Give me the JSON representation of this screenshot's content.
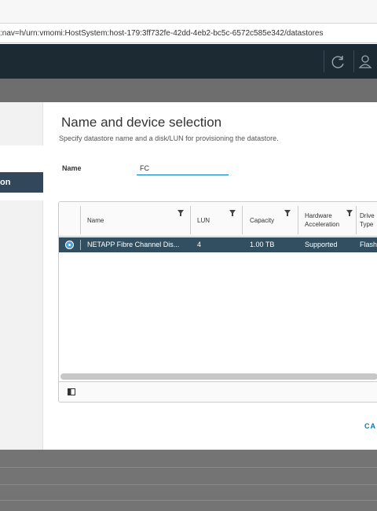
{
  "browser": {
    "address": ":nav=h/urn:vmomi:HostSystem:host-179:3ff732fe-42dd-4eb2-bc5c-6572c585e342/datastores"
  },
  "sidebar": {
    "active_step": "on"
  },
  "page": {
    "title": "Name and device selection",
    "subtitle": "Specify datastore name and a disk/LUN for provisioning the datastore."
  },
  "form": {
    "name_label": "Name",
    "name_value": "FC"
  },
  "grid": {
    "columns": [
      {
        "label": "Name"
      },
      {
        "label": "LUN"
      },
      {
        "label": "Capacity"
      },
      {
        "label": "Hardware\nAcceleration"
      },
      {
        "label": "Drive\nType"
      }
    ],
    "rows": [
      {
        "name": "NETAPP Fibre Channel Dis...",
        "lun": "4",
        "capacity": "1.00 TB",
        "hardware_acceleration": "Supported",
        "drive_type": "Flash"
      }
    ]
  },
  "footer": {
    "cancel_label": "CA"
  },
  "colors": {
    "header_bg": "#1b2a33",
    "selected_row": "#324f61",
    "accent": "#0079b8"
  }
}
